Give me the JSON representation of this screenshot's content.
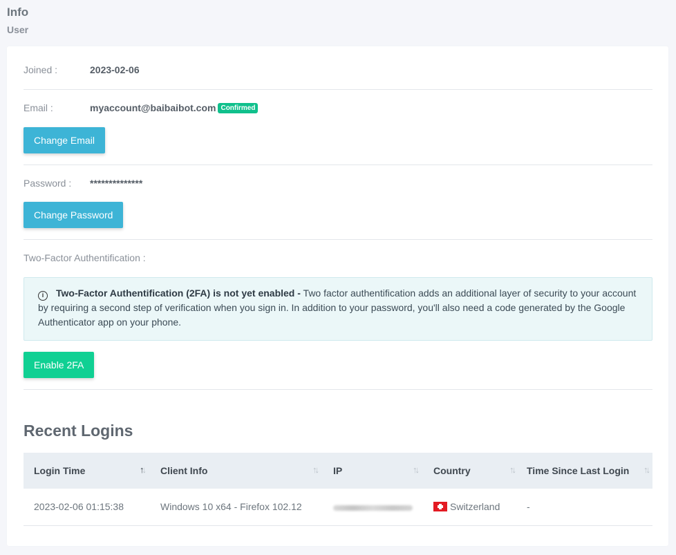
{
  "header": {
    "title": "Info",
    "subtitle": "User"
  },
  "account": {
    "joined_label": "Joined :",
    "joined_value": "2023-02-06",
    "email_label": "Email :",
    "email_value": "myaccount@baibaibot.com",
    "email_badge": "Confirmed",
    "change_email_label": "Change Email",
    "password_label": "Password :",
    "password_value": "**************",
    "change_password_label": "Change Password",
    "tfa_label": "Two-Factor Authentification :",
    "tfa_alert_title": "Two-Factor Authentification (2FA) is not yet enabled -",
    "tfa_alert_body": "Two factor authentification adds an additional layer of security to your account by requiring a second step of verification when you sign in. In addition to your password, you'll also need a code generated by the Google Authenticator app on your phone.",
    "enable_tfa_label": "Enable 2FA"
  },
  "recent_logins": {
    "title": "Recent Logins",
    "columns": [
      "Login Time",
      "Client Info",
      "IP",
      "Country",
      "Time Since Last Login"
    ],
    "rows": [
      {
        "login_time": "2023-02-06 01:15:38",
        "client_info": "Windows 10 x64 - Firefox 102.12",
        "ip": "",
        "country": "Switzerland",
        "since_last": "-"
      }
    ]
  },
  "icons": {
    "info": "info-circle-icon",
    "sort": "sort-arrows-icon",
    "flag": "flag-switzerland-icon"
  },
  "colors": {
    "info_button": "#3db4d6",
    "success_button": "#10d093",
    "badge": "#10c08c",
    "alert_bg": "#ebf7f8"
  }
}
